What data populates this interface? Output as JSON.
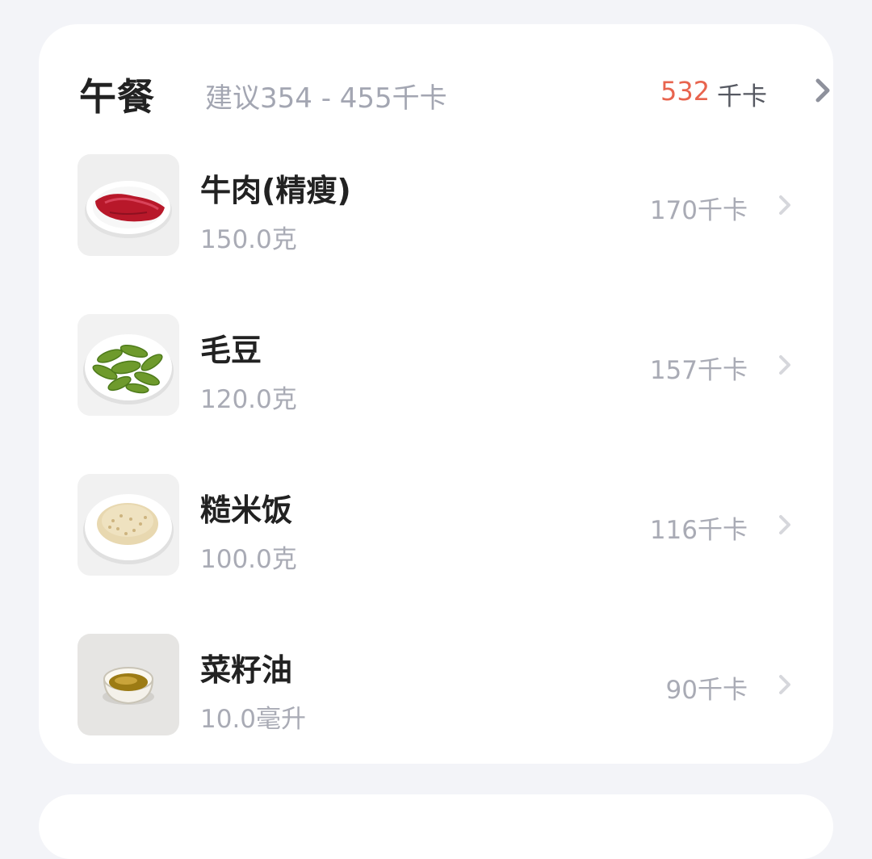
{
  "meal": {
    "title": "午餐",
    "suggestion": "建议354 - 455千卡",
    "total": "532",
    "total_unit": "千卡",
    "accent_color": "#e8644e"
  },
  "foods": [
    {
      "name": "牛肉(精瘦)",
      "amount": "150.0克",
      "kcal": "170千卡",
      "icon": "beef-plate"
    },
    {
      "name": "毛豆",
      "amount": "120.0克",
      "kcal": "157千卡",
      "icon": "edamame-plate"
    },
    {
      "name": "糙米饭",
      "amount": "100.0克",
      "kcal": "116千卡",
      "icon": "brown-rice-plate"
    },
    {
      "name": "菜籽油",
      "amount": "10.0毫升",
      "kcal": "90千卡",
      "icon": "rapeseed-oil-bowl"
    }
  ]
}
